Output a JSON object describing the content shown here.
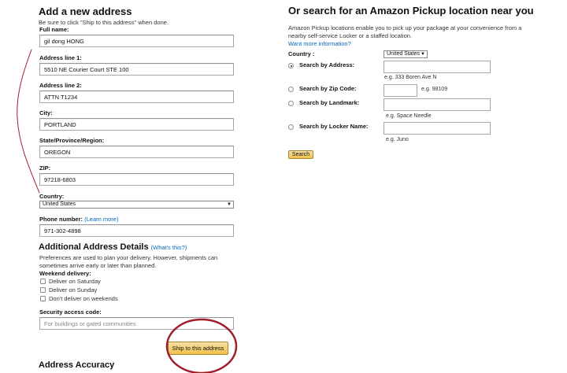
{
  "left": {
    "title": "Add a new address",
    "instruction": "Be sure to click \"Ship to this address\" when done.",
    "full_name": {
      "label": "Full name:",
      "value": "gil dong HONG"
    },
    "address1": {
      "label": "Address line 1:",
      "value": "5510 NE Courier Court STE 100"
    },
    "address2": {
      "label": "Address line 2:",
      "value": "ATTN T1234"
    },
    "city": {
      "label": "City:",
      "value": "PORTLAND"
    },
    "state": {
      "label": "State/Province/Region:",
      "value": "OREGON"
    },
    "zip": {
      "label": "ZIP:",
      "value": "97218-6803"
    },
    "country": {
      "label": "Country:",
      "value": "United States"
    },
    "phone": {
      "label": "Phone number:",
      "link": "(Learn more)",
      "value": "971-302-4898"
    },
    "details_title": "Additional Address Details",
    "details_link": "(What's this?)",
    "details_note_1": "Preferences are used to plan your delivery. However, shipments can",
    "details_note_2": "sometimes arrive early or later than planned.",
    "weekend_label": "Weekend delivery:",
    "weekend_options": [
      "Deliver on Saturday",
      "Deliver on Sunday",
      "Don't deliver on weekends"
    ],
    "security": {
      "label": "Security access code:",
      "placeholder": "For buildings or gated communities"
    },
    "ship_button": "Ship to this address",
    "accuracy_title": "Address Accuracy"
  },
  "right": {
    "title": "Or search for an Amazon Pickup location near you",
    "desc_1": "Amazon Pickup locations enable you to pick up your package at your convenience from a",
    "desc_2": "nearby self-service Locker or a staffed location.",
    "more_link": "Want more information?",
    "country_label": "Country :",
    "country_value": "United States",
    "search_address": {
      "label": "Search by Address:",
      "example": "e.g. 333 Boren Ave N"
    },
    "search_zip": {
      "label": "Search by Zip Code:",
      "example": "e.g. 98109"
    },
    "search_landmark": {
      "label": "Search by Landmark:",
      "example": "e.g. Space Needle"
    },
    "search_locker": {
      "label": "Search by Locker Name:",
      "example": "e.g. Juno"
    },
    "search_button": "Search"
  },
  "annotation_color": "#a0202a"
}
